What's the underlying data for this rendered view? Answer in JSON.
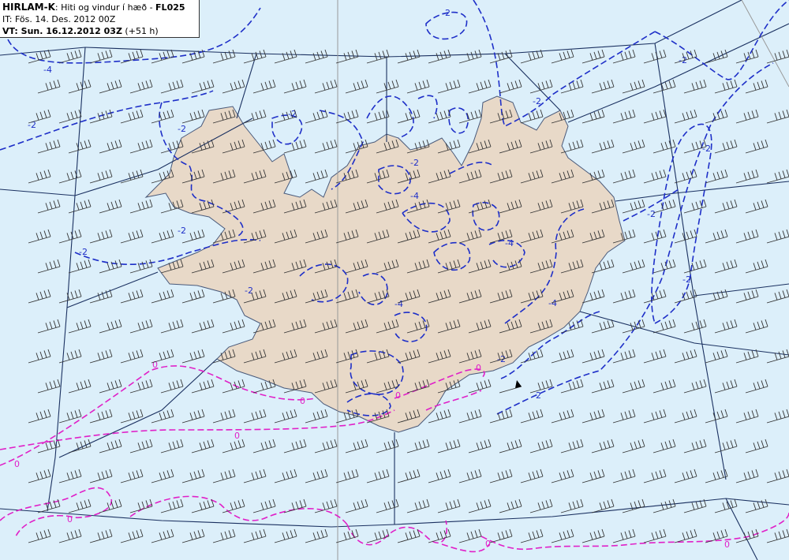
{
  "header": {
    "model": "HIRLAM-K",
    "title_sep": ": ",
    "title": "Hiti og vindur í hæð - ",
    "level": "FL025",
    "it_prefix": "IT: ",
    "it_value": "Fös. 14. Des. 2012 00Z",
    "vt_prefix": "VT: Sun. 16.12.2012 03Z",
    "vt_offset": " (+51 h)"
  },
  "colors": {
    "sea": "#dceffa",
    "land": "#e8d9c8",
    "coast": "#4a5a7a",
    "grid": "#1a3060",
    "contour_negative": "#1e2fc8",
    "contour_zero": "#e020c8",
    "barb": "#333333"
  },
  "contour_labels": {
    "neg2": "-2",
    "neg4": "-4",
    "zero": "0"
  },
  "wind_barbs": {
    "direction": "from west-southwest",
    "typical_speed_kt": 35,
    "strong_flag_speed_kt": 50
  }
}
